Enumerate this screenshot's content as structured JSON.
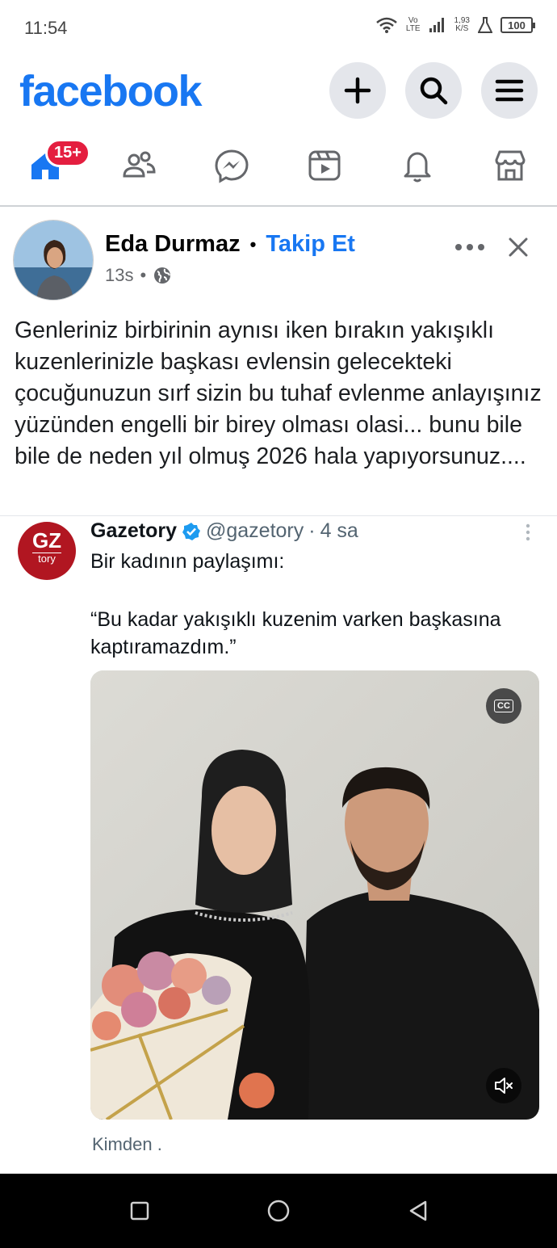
{
  "status_bar": {
    "time": "11:54",
    "network_top": "Vo",
    "network_bottom": "LTE",
    "speed_value": "1,93",
    "speed_unit": "K/S",
    "battery": "100"
  },
  "header": {
    "logo": "facebook",
    "icons": [
      "plus-icon",
      "search-icon",
      "menu-icon"
    ]
  },
  "nav": {
    "badge": "15+",
    "tabs": [
      "home-icon",
      "friends-icon",
      "messenger-icon",
      "video-icon",
      "notifications-icon",
      "marketplace-icon"
    ]
  },
  "post": {
    "author": "Eda Durmaz",
    "separator": "•",
    "follow_label": "Takip Et",
    "time": "13s",
    "meta_separator": "•",
    "text": "Genleriniz birbirinin aynısı iken bırakın yakışıklı kuzenlerinizle başkası evlensin gelecekteki çocuğunuzun sırf sizin bu tuhaf evlenme anlayışınız yüzünden engelli bir birey olması olasi... bunu bile bile de neden yıl olmuş 2026 hala yapıyorsunuz...."
  },
  "embed": {
    "logo_text": "GZ",
    "logo_sub": "tory",
    "name": "Gazetory",
    "handle": "@gazetory",
    "dot": "·",
    "time": "4 sa",
    "intro": "Bir kadının paylaşımı:",
    "quote": "“Bu kadar yakışıklı kuzenim varken başkasına kaptıramazdım.”",
    "cc_label": "CC",
    "from": "Kimden ."
  },
  "colors": {
    "brand": "#1877f2",
    "badge": "#e41e3f",
    "gazetory": "#b11621",
    "verified": "#1d9bf0"
  }
}
